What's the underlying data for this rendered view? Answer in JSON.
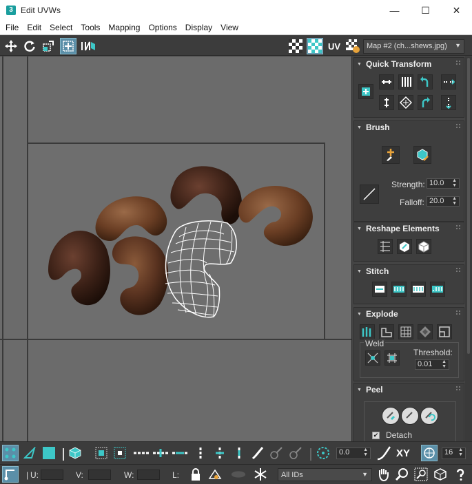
{
  "window": {
    "app_icon_glyph": "3",
    "title": "Edit UVWs",
    "minimize_glyph": "—",
    "maximize_glyph": "☐",
    "close_glyph": "✕"
  },
  "menu": [
    "File",
    "Edit",
    "Select",
    "Tools",
    "Mapping",
    "Options",
    "Display",
    "View"
  ],
  "toolbar": {
    "uv_label": "UV",
    "map_selector": "Map #2 (ch...shews.jpg)"
  },
  "rollouts": {
    "quick_transform": {
      "title": "Quick Transform"
    },
    "brush": {
      "title": "Brush",
      "strength_label": "Strength:",
      "strength_value": "10.0",
      "falloff_label": "Falloff:",
      "falloff_value": "20.0"
    },
    "reshape": {
      "title": "Reshape Elements"
    },
    "stitch": {
      "title": "Stitch"
    },
    "explode": {
      "title": "Explode",
      "weld_label": "Weld",
      "threshold_label": "Threshold:",
      "threshold_value": "0.01"
    },
    "peel": {
      "title": "Peel",
      "detach_label": "Detach",
      "detach_checked": true
    }
  },
  "bottom_bar": {
    "rotation_value": "0.0",
    "xy_label": "XY",
    "snap_value": "16",
    "u_label": "U:",
    "v_label": "V:",
    "w_label": "W:",
    "l_label": "L:",
    "id_filter": "All IDs"
  },
  "colors": {
    "accent": "#3dc7c7",
    "viewport_bg": "#6b6b6b",
    "panel_bg": "#444444",
    "mesh_stroke": "#ffffff"
  }
}
